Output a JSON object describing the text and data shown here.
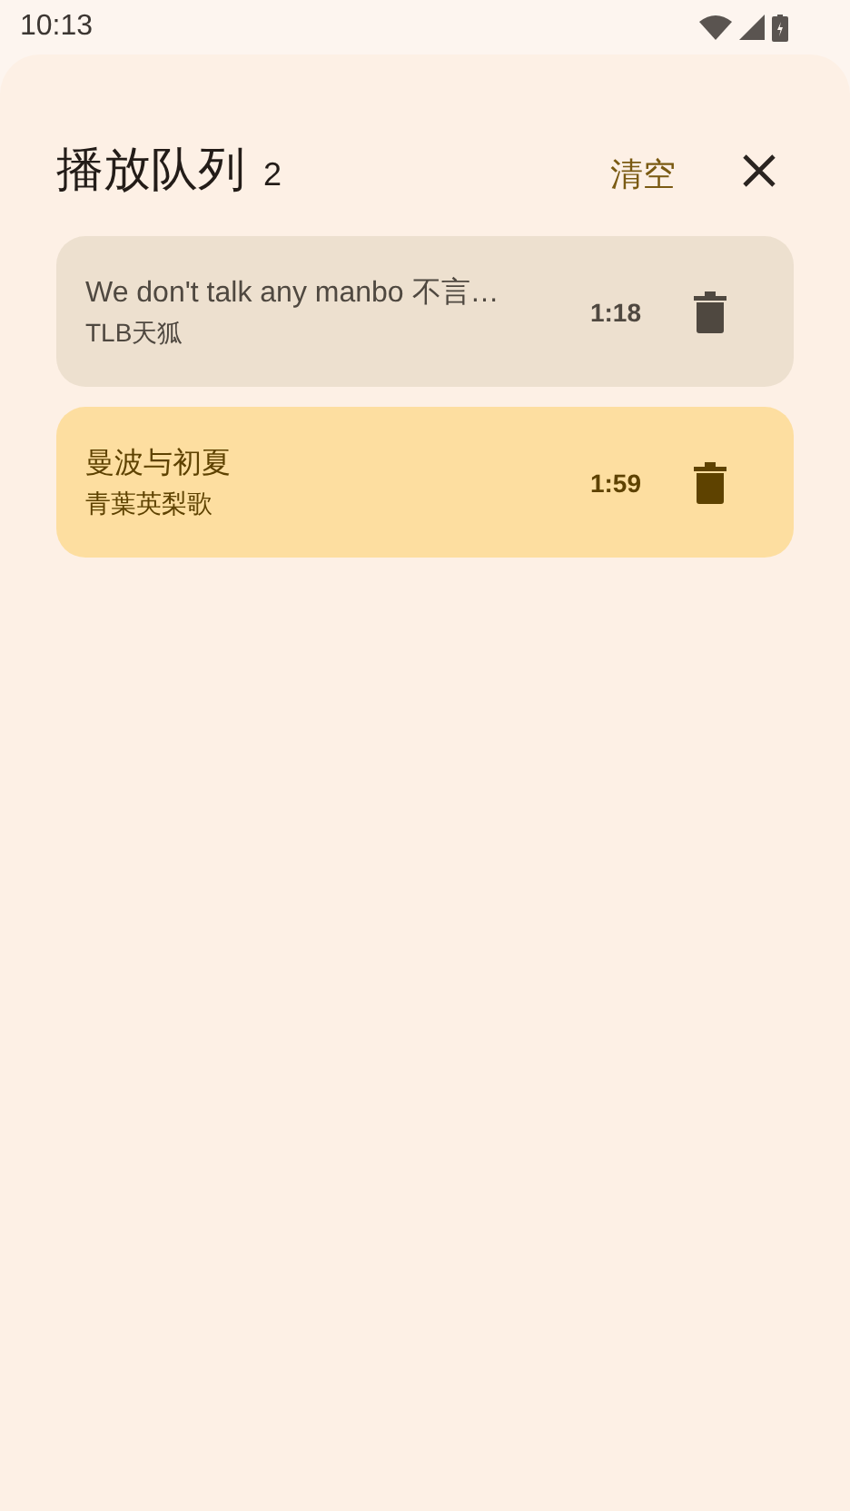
{
  "status_bar": {
    "time": "10:13"
  },
  "header": {
    "title": "播放队列",
    "count": "2",
    "clear_label": "清空"
  },
  "queue": [
    {
      "title": "We don't talk any manbo 不言…",
      "artist": "TLB天狐",
      "duration": "1:18",
      "selected": false
    },
    {
      "title": "曼波与初夏",
      "artist": "青葉英梨歌",
      "duration": "1:59",
      "selected": true
    }
  ]
}
